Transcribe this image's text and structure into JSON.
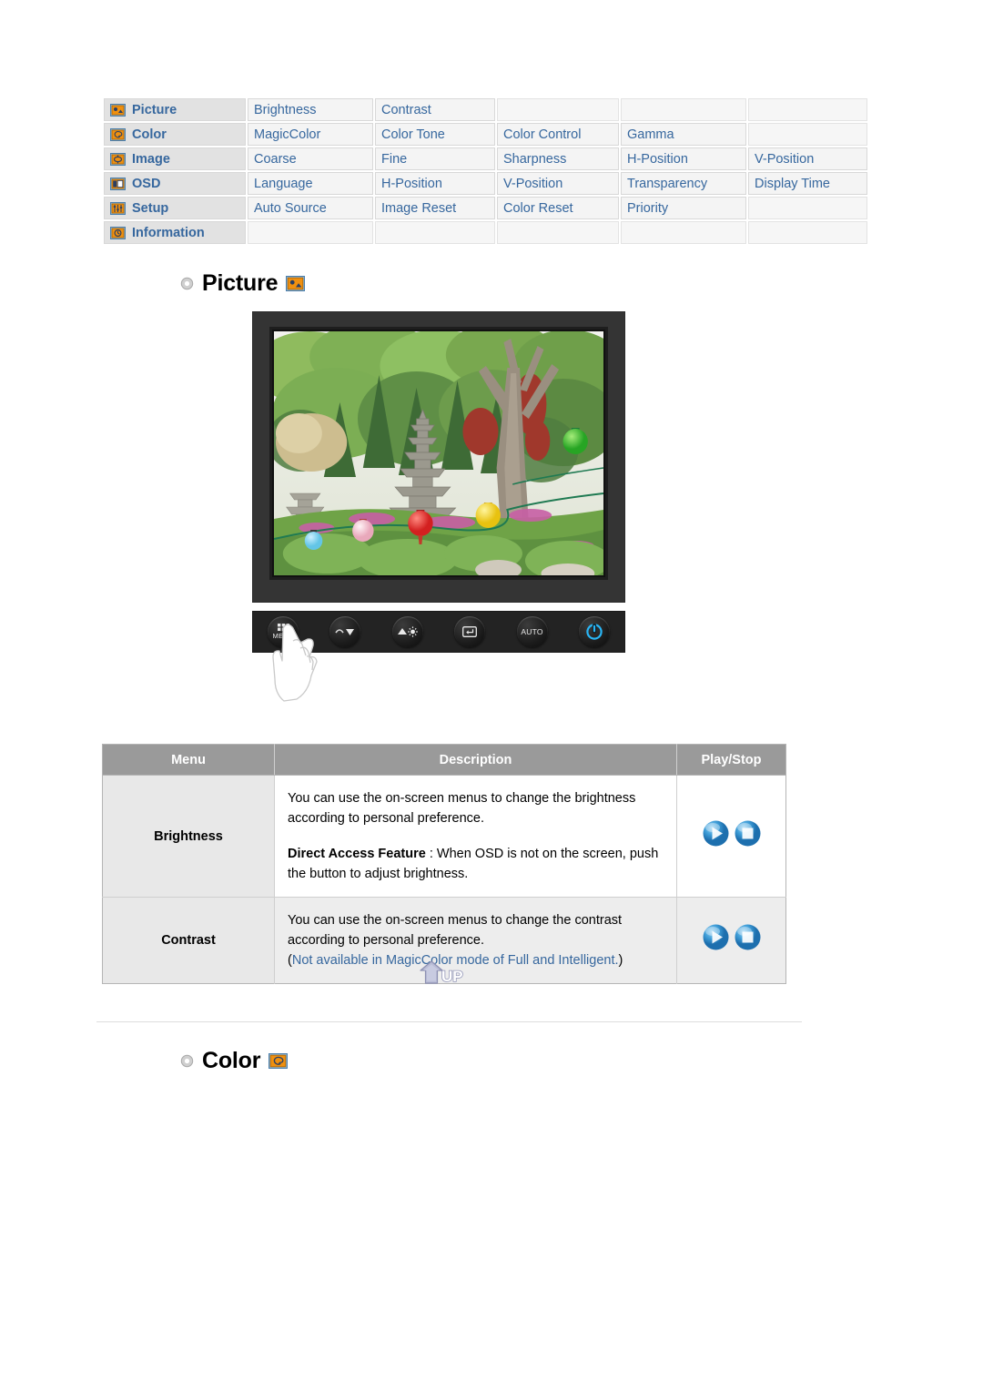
{
  "nav": {
    "rows": [
      {
        "icon": "picture-icon",
        "label": "Picture",
        "items": [
          "Brightness",
          "Contrast",
          "",
          "",
          ""
        ]
      },
      {
        "icon": "color-icon",
        "label": "Color",
        "items": [
          "MagicColor",
          "Color Tone",
          "Color Control",
          "Gamma",
          ""
        ]
      },
      {
        "icon": "image-icon",
        "label": "Image",
        "items": [
          "Coarse",
          "Fine",
          "Sharpness",
          "H-Position",
          "V-Position"
        ]
      },
      {
        "icon": "osd-icon",
        "label": "OSD",
        "items": [
          "Language",
          "H-Position",
          "V-Position",
          "Transparency",
          "Display Time"
        ]
      },
      {
        "icon": "setup-icon",
        "label": "Setup",
        "items": [
          "Auto Source",
          "Image Reset",
          "Color Reset",
          "Priority",
          ""
        ]
      },
      {
        "icon": "information-icon",
        "label": "Information",
        "items": [
          "",
          "",
          "",
          "",
          ""
        ]
      }
    ]
  },
  "sections": {
    "picture": {
      "title": "Picture",
      "icon": "picture-icon",
      "bullet": "circle-bullet-icon"
    },
    "color": {
      "title": "Color",
      "icon": "color-icon",
      "bullet": "circle-bullet-icon"
    }
  },
  "monitor": {
    "screen_description": "Korean garden photo with stone pagoda, trees and colored paper lanterns",
    "buttons": [
      {
        "name": "menu-button",
        "label": "MENU"
      },
      {
        "name": "down-button",
        "label": ""
      },
      {
        "name": "up-brightness-button",
        "label": ""
      },
      {
        "name": "enter-button",
        "label": ""
      },
      {
        "name": "auto-button",
        "label": "AUTO"
      },
      {
        "name": "power-button",
        "label": ""
      }
    ],
    "power_color": "#29b6f6"
  },
  "desc_table": {
    "headers": [
      "Menu",
      "Description",
      "Play/Stop"
    ],
    "rows": [
      {
        "menu": "Brightness",
        "paragraphs": [
          {
            "bold_lead": "",
            "text": "You can use the on-screen menus to change the brightness according to personal preference."
          },
          {
            "bold_lead": "Direct Access Feature",
            "text": " : When OSD is not on the screen, push the button to adjust brightness."
          }
        ],
        "note": "",
        "play_label": "play-icon",
        "stop_label": "stop-icon"
      },
      {
        "menu": "Contrast",
        "paragraphs": [
          {
            "bold_lead": "",
            "text": "You can use the on-screen menus to change the contrast according to personal preference."
          }
        ],
        "note_open": "(",
        "note": "Not available in MagicColor mode of Full and Intelligent.",
        "note_close": ")",
        "play_label": "play-icon",
        "stop_label": "stop-icon"
      }
    ]
  },
  "up_button": {
    "label": "UP",
    "name": "up-scroll-button"
  },
  "colors": {
    "link_blue": "#36679e",
    "nav_label_bg": "#e2e2e2",
    "table_header_bg": "#9a9a9a",
    "icon_orange": "#f0900f",
    "bezel": "#343434"
  }
}
